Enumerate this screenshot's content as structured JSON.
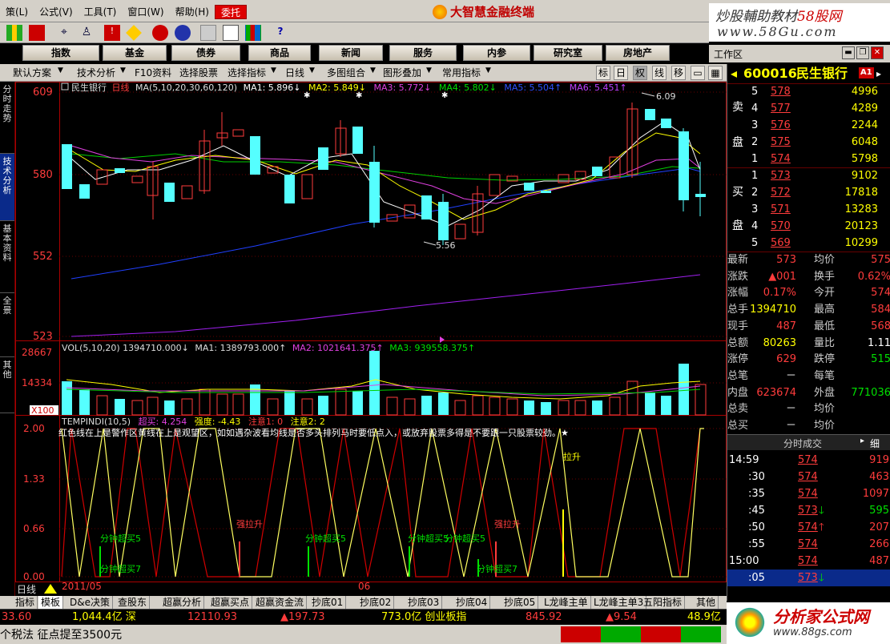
{
  "menu": [
    "策(L)",
    "公式(V)",
    "工具(T)",
    "窗口(W)",
    "帮助(H)",
    "委托"
  ],
  "app_title": "大智慧金融终端",
  "watermark_top": {
    "line1_a": "炒股輔助教材",
    "line1_b": "58股网",
    "line2": "www.58Gu.com"
  },
  "nav_buttons": [
    "指数",
    "基金",
    "债券",
    "商品",
    "新闻",
    "服务",
    "内参",
    "研究室",
    "房地产"
  ],
  "workarea_label": "工作区",
  "tabbar": {
    "items": [
      "默认方案",
      "技术分析",
      "F10资料",
      "选择股票",
      "选择指标",
      "日线",
      "多图组合",
      "图形叠加",
      "常用指标"
    ],
    "square_buttons": [
      "标",
      "日",
      "权",
      "线",
      "移"
    ]
  },
  "sidebar_tabs": [
    "分时走势",
    "技术分析",
    "基本资料",
    "全景",
    "其他"
  ],
  "main_chart": {
    "stock_name": "民生银行",
    "period": "日线",
    "ma_legend": "MA(5,10,20,30,60,120)",
    "ma1": "MA1: 5.896↓",
    "ma2": "MA2: 5.849↓",
    "ma3": "MA3: 5.772↓",
    "ma4": "MA4: 5.802↓",
    "ma5": "MA5: 5.504↑",
    "ma6": "MA6: 5.451↑",
    "y_labels": [
      "609",
      "580",
      "552",
      "523"
    ],
    "high_annot": "6.09",
    "low_annot": "5.56"
  },
  "vol_chart": {
    "legend": "VOL(5,10,20) 1394710.000↓",
    "ma1": "MA1: 1389793.000↑",
    "ma2": "MA2: 1021641.375↑",
    "ma3": "MA3: 939558.375↑",
    "y_labels": [
      "28667",
      "14334"
    ],
    "unit": "X100"
  },
  "ind_chart": {
    "legend": "TEMPINDI(10,5)",
    "p1": "超买: 4.254",
    "p2": "强度: -4.43",
    "p3": "注意1: 0",
    "p4": "注意2: 2",
    "note": "红色线在上是警作区黄线在上是观望区，如如遇杂波看均线是否多头排列马时要低点入，或放弃股票多得是不要跟一只股票较劲。★",
    "y_labels": [
      "2.00",
      "1.33",
      "0.66",
      "0.00"
    ],
    "annots": [
      "分钟超买5",
      "分钟超买7",
      "强拉升",
      "分钟超买5",
      "分钟超买5",
      "分钟超买5",
      "强拉升",
      "分钟超买7",
      "拉升"
    ],
    "date_left": "2011/05",
    "date_mid": "06"
  },
  "period_label": "日线",
  "bottom_tabs": [
    "指标",
    "模板",
    "D&e决策",
    "查股东",
    "超赢分析",
    "超赢买点",
    "超赢资金流",
    "抄底01",
    "抄底02",
    "抄底03",
    "抄底04",
    "抄底05",
    "L龙峰主单",
    "L龙峰主单3",
    "五阳指标",
    "其他"
  ],
  "ticker": {
    "v1": "33.60",
    "v2": "1,044.4亿 深",
    "v3": "12110.93",
    "v4": "▲197.73",
    "v5": "773.0亿 创业板指",
    "v6": "845.92",
    "v7": "▲9.54",
    "v8": "48.9亿"
  },
  "status_msg": "个税法 征点提至3500元",
  "quote": {
    "code": "600016",
    "name": "民生银行",
    "badge": "A1",
    "sell_label": [
      "卖",
      "盘"
    ],
    "buy_label": [
      "买",
      "盘"
    ],
    "asks": [
      [
        "5",
        "578",
        "4996"
      ],
      [
        "4",
        "577",
        "4289"
      ],
      [
        "3",
        "576",
        "2244"
      ],
      [
        "2",
        "575",
        "6048"
      ],
      [
        "1",
        "574",
        "5798"
      ]
    ],
    "bids": [
      [
        "1",
        "573",
        "9102"
      ],
      [
        "2",
        "572",
        "17818"
      ],
      [
        "3",
        "571",
        "13283"
      ],
      [
        "4",
        "570",
        "20123"
      ],
      [
        "5",
        "569",
        "10299"
      ]
    ],
    "stats": [
      [
        "最新",
        "573",
        "均价",
        "575"
      ],
      [
        "涨跌",
        "▲001",
        "换手",
        "0.62%"
      ],
      [
        "涨幅",
        "0.17%",
        "今开",
        "574"
      ],
      [
        "总手",
        "1394710",
        "最高",
        "584"
      ],
      [
        "现手",
        "487",
        "最低",
        "568"
      ],
      [
        "总额",
        "80263",
        "量比",
        "1.11"
      ],
      [
        "涨停",
        "629",
        "跌停",
        "515"
      ],
      [
        "总笔",
        "－",
        "每笔",
        ""
      ],
      [
        "内盘",
        "623674",
        "外盘",
        "771036"
      ],
      [
        "总卖",
        "－",
        "均价",
        ""
      ],
      [
        "总买",
        "－",
        "均价",
        ""
      ]
    ],
    "trade_header": "分时成交",
    "trade_header_right": "细",
    "trades": [
      [
        "14:59",
        "574",
        "919",
        ""
      ],
      [
        ":30",
        "574",
        "463",
        ""
      ],
      [
        ":35",
        "574",
        "1097",
        ""
      ],
      [
        ":45",
        "573",
        "595",
        "dn"
      ],
      [
        ":50",
        "574",
        "207",
        "up"
      ],
      [
        ":55",
        "574",
        "266",
        ""
      ],
      [
        "15:00",
        "574",
        "487",
        ""
      ],
      [
        ":05",
        "573",
        "",
        "dn"
      ]
    ]
  },
  "watermark_bot": {
    "line1": "分析家公式网",
    "line2": "www.88gs.com"
  }
}
